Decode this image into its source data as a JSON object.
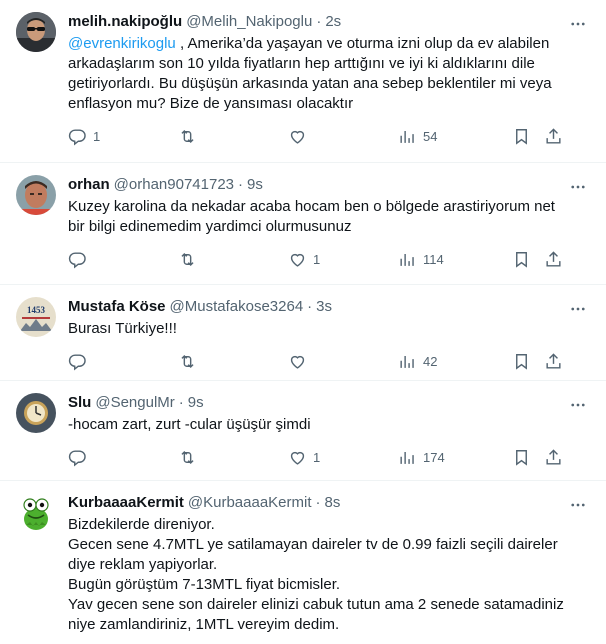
{
  "tweets": [
    {
      "name": "melih.nakipoğlu",
      "handle": "@Melih_Nakipoglu",
      "time": "2s",
      "mention": "@evrenkirikoglu",
      "text": " , Amerika’da yaşayan ve oturma izni olup da ev alabilen arkadaşlarım son 10 yılda fiyatların hep arttığını ve iyi ki aldıklarını dile getiriyorlardı. Bu düşüşün arkasında yatan ana sebep beklentiler mi veya enflasyon mu? Bize de yansıması olacaktır",
      "replies": "1",
      "retweets": "",
      "likes": "",
      "views": "54",
      "avatar_color": "#3a3f45",
      "avatar_icon": "person-sunglasses"
    },
    {
      "name": "orhan",
      "handle": "@orhan90741723",
      "time": "9s",
      "text": "Kuzey karolina da nekadar acaba hocam ben o bölgede arastiriyorum net bir bilgi edinemedim yardimci olurmusunuz",
      "replies": "",
      "retweets": "",
      "likes": "1",
      "views": "114",
      "avatar_color": "#b07a5c",
      "avatar_icon": "person-photo"
    },
    {
      "name": "Mustafa Köse",
      "handle": "@Mustafakose3264",
      "time": "3s",
      "text": "Burası Türkiye!!!",
      "replies": "",
      "retweets": "",
      "likes": "",
      "views": "42",
      "avatar_color": "#d9d2c0",
      "avatar_icon": "emblem-1453"
    },
    {
      "name": "Slu",
      "handle": "@SengulMr",
      "time": "9s",
      "text": "-hocam zart, zurt -cular üşüşür şimdi",
      "replies": "",
      "retweets": "",
      "likes": "1",
      "views": "174",
      "avatar_color": "#3c4a5a",
      "avatar_icon": "clock-photo"
    },
    {
      "name": "KurbaaaaKermit",
      "handle": "@KurbaaaaKermit",
      "time": "8s",
      "lines": [
        "Bizdekilerde direniyor.",
        "Gecen sene 4.7MTL ye satilamayan daireler tv de 0.99 faizli seçili daireler diye reklam yapiyorlar.",
        "Bugün görüştüm 7-13MTL fiyat bicmisler.",
        "Yav gecen sene son daireler elinizi cabuk tutun ama 2 senede satamadiniz niye zamlandiriniz, 1MTL vereyim dedim."
      ],
      "avatar_color": "#ffffff",
      "avatar_icon": "kermit-frog"
    }
  ],
  "labels": {
    "dot": "·"
  }
}
